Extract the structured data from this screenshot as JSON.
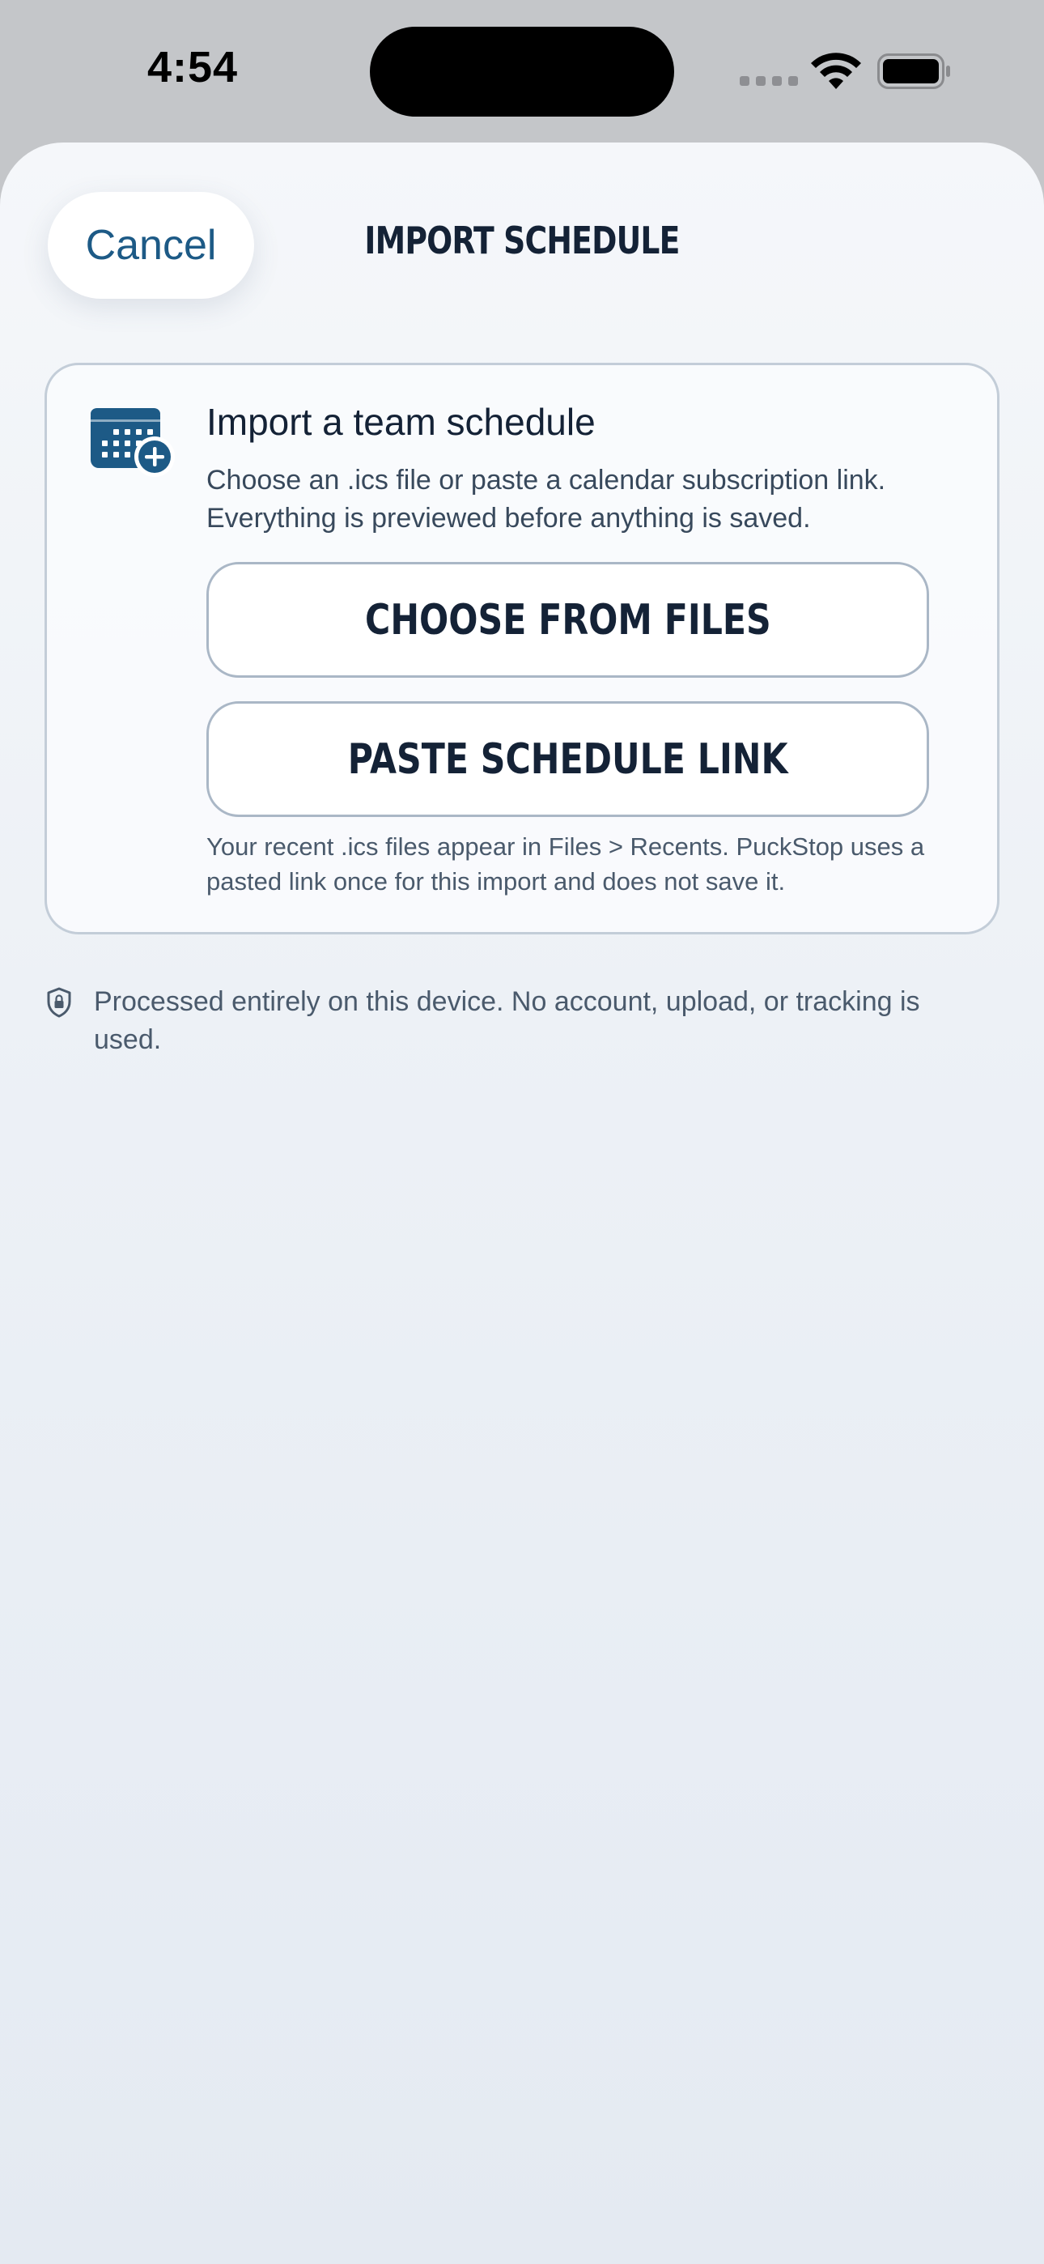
{
  "status_bar": {
    "time": "4:54",
    "icons": [
      "cellular-signal-icon",
      "wifi-icon",
      "battery-icon"
    ]
  },
  "header": {
    "cancel_label": "Cancel",
    "title": "IMPORT SCHEDULE"
  },
  "import_card": {
    "icon": "calendar-add-icon",
    "title": "Import a team schedule",
    "description": "Choose an .ics file or paste a calendar subscription link. Everything is previewed before anything is saved.",
    "choose_files_label": "CHOOSE FROM FILES",
    "paste_link_label": "PASTE SCHEDULE LINK",
    "note": "Your recent .ics files appear in Files > Recents. PuckStop uses a pasted link once for this import and does not save it."
  },
  "privacy": {
    "icon": "shield-lock-icon",
    "text": "Processed entirely on this device. No account, upload, or tracking is used."
  },
  "colors": {
    "accent": "#1d5a86",
    "heading": "#142236",
    "body_text": "#38495c",
    "secondary_text": "#4a5a6c",
    "card_border": "#c3cdd8"
  }
}
